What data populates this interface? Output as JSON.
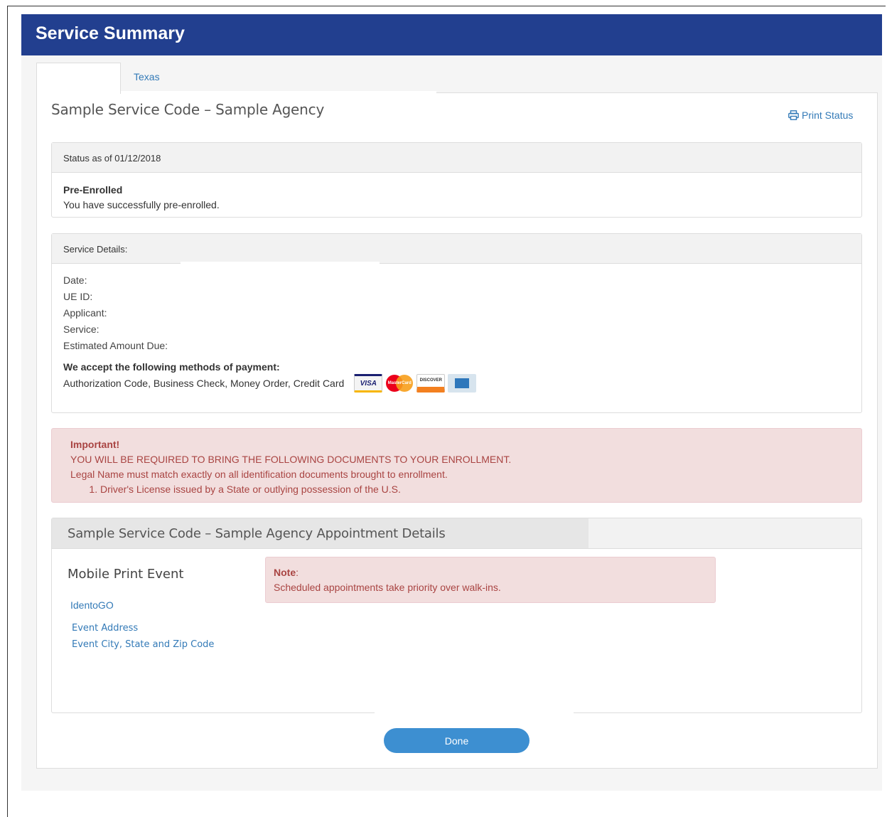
{
  "header": {
    "title": "Service Summary"
  },
  "tabs": [
    {
      "label": ""
    },
    {
      "label": "Texas"
    }
  ],
  "page": {
    "title": "Sample Service Code – Sample Agency",
    "print_label": "Print Status"
  },
  "status_panel": {
    "heading": "Status as of 01/12/2018",
    "status": "Pre-Enrolled",
    "message": "You have successfully pre-enrolled."
  },
  "details_panel": {
    "heading": "Service Details:",
    "fields": [
      "Date:",
      "UE ID:",
      "Applicant:",
      "Service:",
      "Estimated Amount Due:"
    ],
    "payment_heading": "We accept the following methods of payment:",
    "payment_methods": "Authorization Code, Business Check, Money Order, Credit Card",
    "cards": [
      "VISA",
      "MasterCard",
      "DISCOVER",
      "AMEX"
    ]
  },
  "important": {
    "title": "Important!",
    "line1": "YOU WILL BE REQUIRED TO BRING THE FOLLOWING DOCUMENTS TO YOUR ENROLLMENT.",
    "line2": "Legal Name must match exactly on all identification documents brought to enrollment.",
    "items": [
      "Driver's License issued by a State or outlying possession of the U.S."
    ]
  },
  "appointment": {
    "heading": "Sample Service Code – Sample Agency Appointment Details",
    "event_title": "Mobile Print Event",
    "provider_link": "IdentoGO",
    "address_line1": "Event Address",
    "address_line2": "Event City, State and Zip Code",
    "note_label": "Note",
    "note_text": "Scheduled appointments take priority over walk-ins."
  },
  "actions": {
    "done_label": "Done"
  },
  "colors": {
    "header": "#223f8f",
    "link": "#337ab7",
    "alert_bg": "#f2dede",
    "alert_text": "#a94442",
    "button": "#3d8fd1"
  }
}
